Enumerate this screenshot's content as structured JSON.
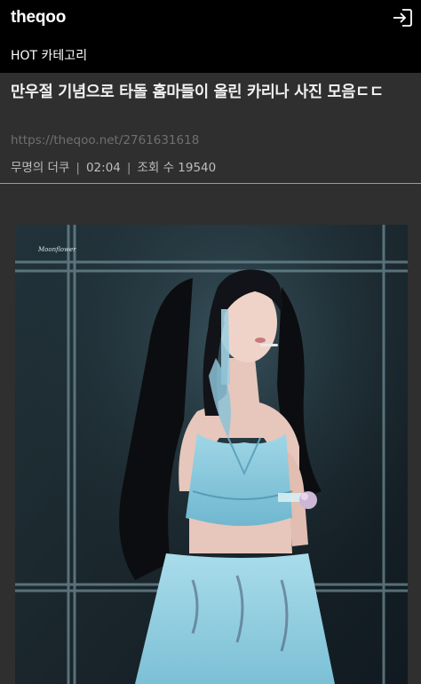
{
  "header": {
    "brand": "theqoo",
    "login_icon": "login-arrow-icon",
    "category_label": "HOT 카테고리"
  },
  "article": {
    "title": "만우절 기념으로 타돌 홈마들이 올린 카리나 사진 모음ㄷㄷ",
    "url": "https://theqoo.net/2761631618",
    "author": "무명의 더쿠",
    "time": "02:04",
    "views_label": "조회 수 19540"
  },
  "image": {
    "watermark": "Moonflower",
    "description_icon": "concert-photo"
  },
  "colors": {
    "topbar": "#000000",
    "page_bg": "#2f2f2f",
    "divider": "#9a9a9a",
    "url": "#6f6f6f"
  }
}
